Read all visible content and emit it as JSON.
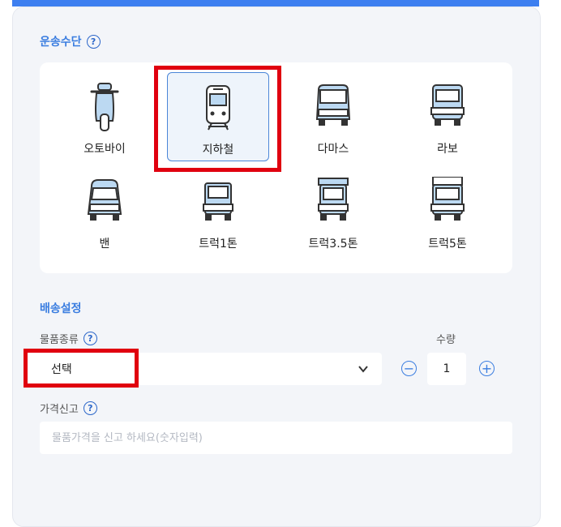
{
  "transport": {
    "section_title": "운송수단",
    "vehicles": [
      {
        "label": "오토바이",
        "icon": "motorcycle-icon"
      },
      {
        "label": "지하철",
        "icon": "subway-icon",
        "selected": true
      },
      {
        "label": "다마스",
        "icon": "minivan-icon"
      },
      {
        "label": "라보",
        "icon": "mini-truck-icon"
      },
      {
        "label": "밴",
        "icon": "van-icon"
      },
      {
        "label": "트럭1톤",
        "icon": "truck-1t-icon"
      },
      {
        "label": "트럭3.5톤",
        "icon": "truck-3-5t-icon"
      },
      {
        "label": "트럭5톤",
        "icon": "truck-5t-icon"
      }
    ]
  },
  "delivery": {
    "section_title": "배송설정",
    "item_type_label": "물품종류",
    "item_type_value": "선택",
    "quantity_label": "수량",
    "quantity_value": "1",
    "price_label": "가격신고",
    "price_placeholder": "물품가격을 신고 하세요(숫자입력)"
  },
  "colors": {
    "accent": "#3a7de0",
    "highlight": "#e0000f",
    "panel_bg": "#f3f5f9",
    "icon_fill": "#bcd9f2",
    "icon_stroke": "#333333"
  }
}
